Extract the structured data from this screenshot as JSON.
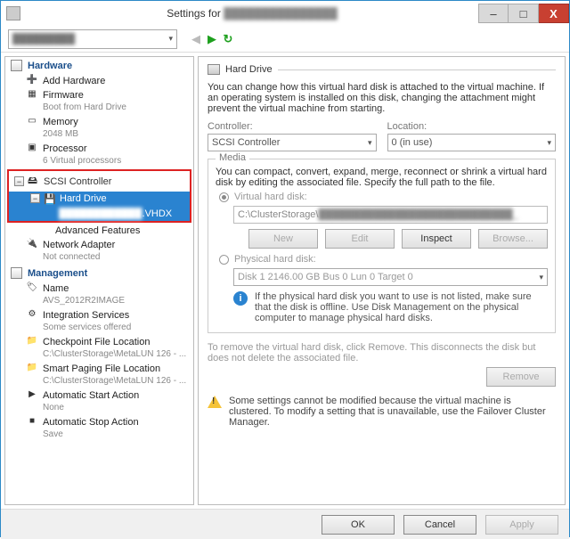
{
  "window": {
    "title_prefix": "Settings for",
    "title_blur": "███████████████"
  },
  "winbtns": {
    "min": "–",
    "max": "□",
    "close": "X"
  },
  "toolbar": {
    "combo_blur": "█████████",
    "back": "◀",
    "fwd": "▶",
    "refresh": "↻"
  },
  "cats": {
    "hardware": "Hardware",
    "management": "Management"
  },
  "hw": {
    "add": {
      "label": "Add Hardware"
    },
    "fw": {
      "label": "Firmware",
      "sub": "Boot from Hard Drive"
    },
    "mem": {
      "label": "Memory",
      "sub": "2048 MB"
    },
    "cpu": {
      "label": "Processor",
      "sub": "6 Virtual processors"
    },
    "scsi": {
      "label": "SCSI Controller"
    },
    "hd": {
      "label": "Hard Drive",
      "sub_blur": "████████████",
      "sub_suffix": ".VHDX"
    },
    "adv": {
      "label": "Advanced Features"
    },
    "net": {
      "label": "Network Adapter",
      "sub": "Not connected"
    }
  },
  "mg": {
    "name": {
      "label": "Name",
      "sub": "AVS_2012R2IMAGE"
    },
    "int": {
      "label": "Integration Services",
      "sub": "Some services offered"
    },
    "chk": {
      "label": "Checkpoint File Location",
      "sub": "C:\\ClusterStorage\\MetaLUN 126 - ..."
    },
    "page": {
      "label": "Smart Paging File Location",
      "sub": "C:\\ClusterStorage\\MetaLUN 126 - ..."
    },
    "start": {
      "label": "Automatic Start Action",
      "sub": "None"
    },
    "stop": {
      "label": "Automatic Stop Action",
      "sub": "Save"
    }
  },
  "main": {
    "heading": "Hard Drive",
    "desc": "You can change how this virtual hard disk is attached to the virtual machine. If an operating system is installed on this disk, changing the attachment might prevent the virtual machine from starting.",
    "controller_label": "Controller:",
    "controller_value": "SCSI Controller",
    "location_label": "Location:",
    "location_value": "0 (in use)",
    "media_title": "Media",
    "media_desc": "You can compact, convert, expand, merge, reconnect or shrink a virtual hard disk by editing the associated file. Specify the full path to the file.",
    "vhd_radio": "Virtual hard disk:",
    "vhd_path_prefix": "C:\\ClusterStorage\\",
    "vhd_path_blur": "████████████████████████████_",
    "btn_new": "New",
    "btn_edit": "Edit",
    "btn_inspect": "Inspect",
    "btn_browse": "Browse...",
    "phd_radio": "Physical hard disk:",
    "phd_value": "Disk 1 2146.00 GB Bus 0 Lun 0 Target 0",
    "phd_info": "If the physical hard disk you want to use is not listed, make sure that the disk is offline. Use Disk Management on the physical computer to manage physical hard disks.",
    "remove_note": "To remove the virtual hard disk, click Remove. This disconnects the disk but does not delete the associated file.",
    "btn_remove": "Remove",
    "warn": "Some settings cannot be modified because the virtual machine is clustered. To modify a setting that is unavailable, use the Failover Cluster Manager."
  },
  "footer": {
    "ok": "OK",
    "cancel": "Cancel",
    "apply": "Apply"
  }
}
